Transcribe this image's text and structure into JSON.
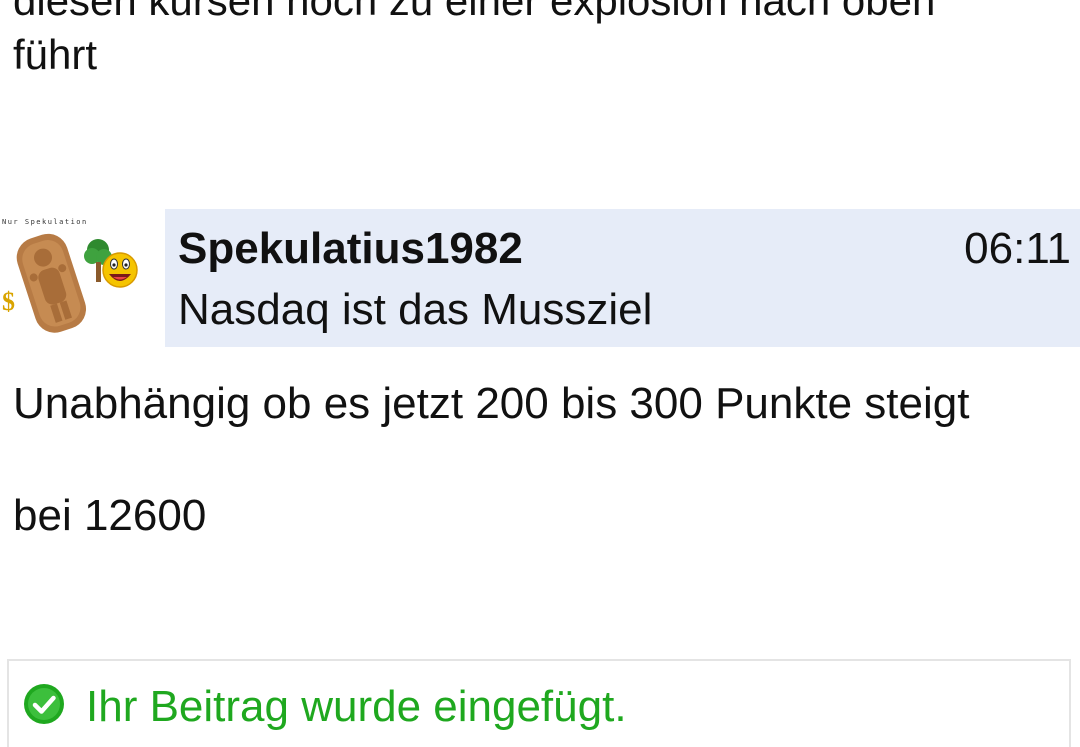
{
  "previous_post": {
    "line1": "diesen kursen noch zu einer explosion nach oben",
    "line2": "führt"
  },
  "post": {
    "avatar_caption": "Nur Spekulation",
    "author": "Spekulatius1982",
    "time": "06:11",
    "subject": "Nasdaq ist das Mussziel",
    "body": [
      "Unabhängig ob es jetzt 200 bis 300 Punkte steigt",
      "bei 12600"
    ]
  },
  "notice": {
    "icon": "check-circle-icon",
    "text": "Ihr Beitrag wurde eingefügt.",
    "color": "#1fa81f"
  },
  "colors": {
    "header_bg": "#e6ecf8",
    "text": "#111111",
    "success": "#1fa81f"
  }
}
